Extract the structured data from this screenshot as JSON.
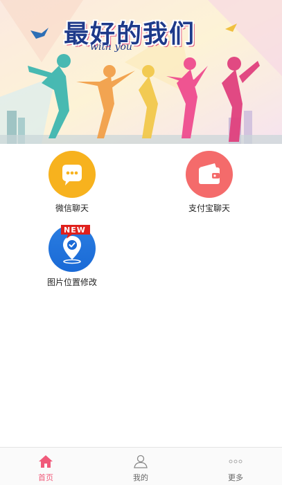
{
  "banner": {
    "title": "最好的我们",
    "subtitle": "with you"
  },
  "features": [
    {
      "label": "微信聊天",
      "icon": "chat-bubble-icon",
      "color": "#f7b21e"
    },
    {
      "label": "支付宝聊天",
      "icon": "wallet-icon",
      "color": "#f46b6b"
    },
    {
      "label": "图片位置修改",
      "icon": "location-pin-icon",
      "color": "#2a7de1",
      "badge": "NEW"
    }
  ],
  "tabbar": {
    "items": [
      {
        "label": "首页",
        "icon": "home-icon",
        "active": true
      },
      {
        "label": "我的",
        "icon": "user-icon",
        "active": false
      },
      {
        "label": "更多",
        "icon": "more-dots-icon",
        "active": false
      }
    ],
    "active_color": "#f05a7a"
  }
}
